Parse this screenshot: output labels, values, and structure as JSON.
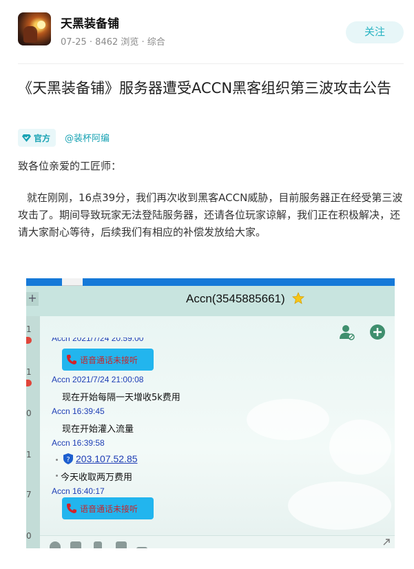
{
  "header": {
    "account_name": "天黑装备铺",
    "date": "07-25",
    "views": "8462 浏览",
    "category": "综合",
    "meta_text": "07-25 · 8462 浏览 · 综合",
    "follow_label": "关注"
  },
  "article": {
    "title": "《天黑装备铺》服务器遭受ACCN黑客组织第三波攻击公告",
    "official_tag": "官方",
    "author": "@装杯阿编",
    "greeting": "致各位亲爱的工匠师：",
    "body": "就在刚刚，16点39分，我们再次收到黑客ACCN威胁，目前服务器正在经受第三波攻击了。期间导致玩家无法登陆服务器，还请各位玩家谅解，我们正在积极解决，还请大家耐心等待，后续我们有相应的补偿发放给大家。"
  },
  "screenshot": {
    "chat_title": "Accn(3545885661)",
    "left_numbers": [
      "1",
      "1",
      "0",
      "1",
      "7",
      "0"
    ],
    "messages": [
      {
        "type": "call",
        "label": "语音通话未接听"
      },
      {
        "type": "head",
        "text": "Accn 2021/7/24 21:00:08"
      },
      {
        "type": "text",
        "text": "现在开始每隔一天增收5k费用"
      },
      {
        "type": "head",
        "text": "Accn  16:39:45"
      },
      {
        "type": "text",
        "text": "现在开始灌入流量"
      },
      {
        "type": "head",
        "text": "Accn  16:39:58"
      },
      {
        "type": "link",
        "text": "203.107.52.85"
      },
      {
        "type": "text",
        "text": "今天收取两万费用"
      },
      {
        "type": "head",
        "text": "Accn  16:40:17"
      },
      {
        "type": "call",
        "label": "语音通话未接听"
      }
    ]
  },
  "colors": {
    "accent": "#27b3c2",
    "follow_bg": "#e7f6f8",
    "chat_name_blue": "#1d3db5",
    "call_bubble": "#22b5ee",
    "missed_call_red": "#c6262c"
  }
}
